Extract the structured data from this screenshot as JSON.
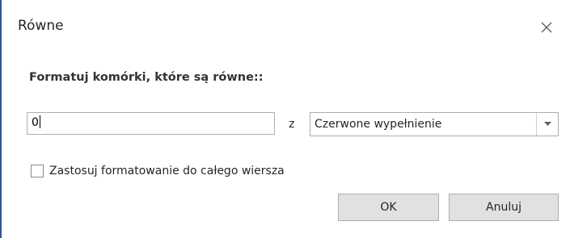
{
  "dialog": {
    "title": "Równe",
    "close_icon": "close-icon",
    "heading": "Formatuj komórki, które są równe::",
    "value_input": {
      "value": "0"
    },
    "conjunction": "z",
    "format_select": {
      "selected": "Czerwone wypełnienie",
      "arrow_icon": "chevron-down-icon"
    },
    "apply_row_checkbox": {
      "label": "Zastosuj formatowanie do całego wiersza",
      "checked": false
    },
    "ok_label": "OK",
    "cancel_label": "Anuluj"
  },
  "colors": {
    "accent_border": "#2b579a",
    "button_bg": "#e1e1e1"
  }
}
